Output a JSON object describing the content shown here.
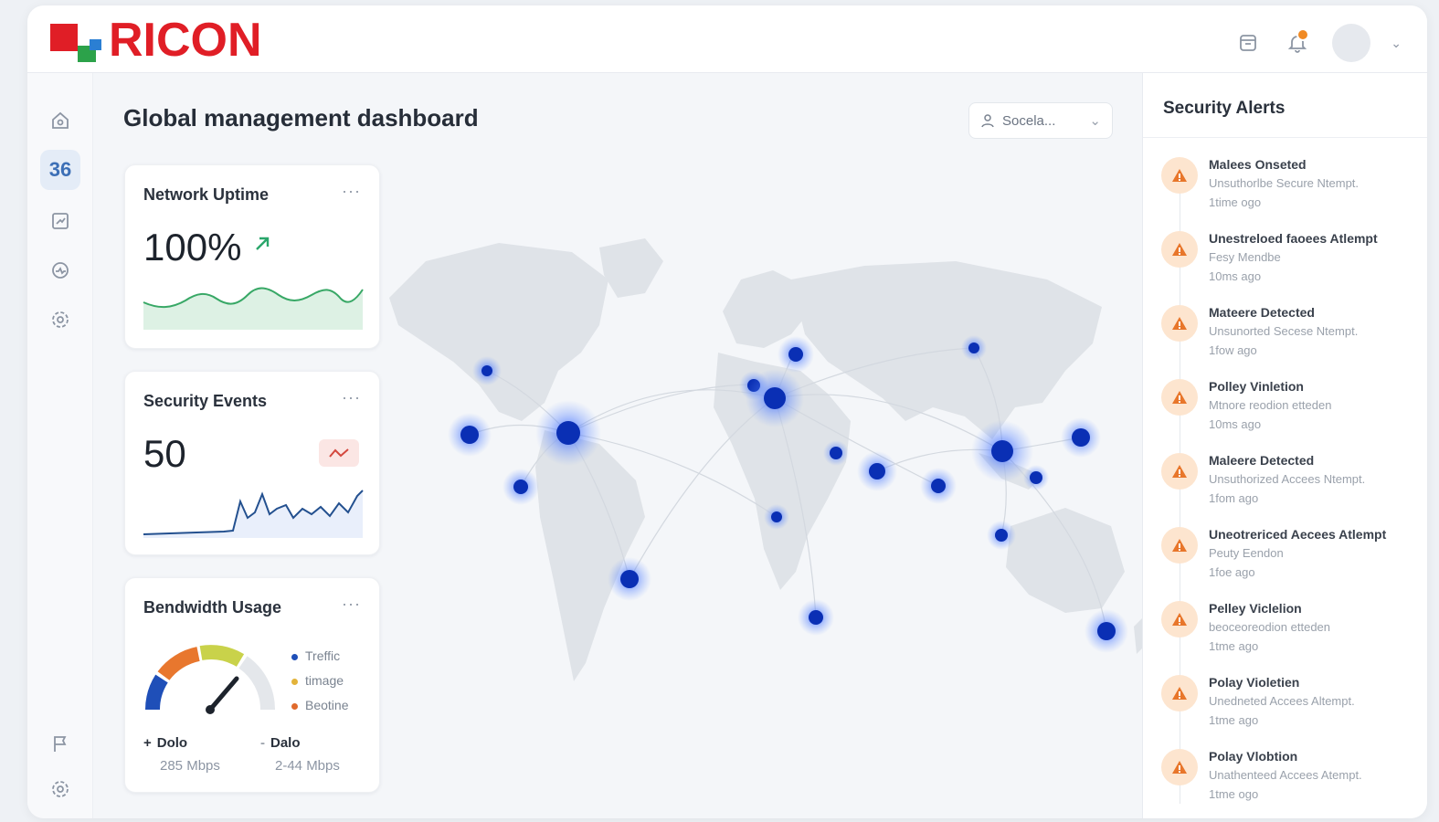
{
  "brand": {
    "name": "RICON"
  },
  "header": {
    "notification_icon": "bell-icon",
    "window_icon": "window-icon"
  },
  "sidebar": {
    "items": [
      {
        "icon": "home-icon"
      },
      {
        "icon": "dashboard-icon",
        "label": "36",
        "active": true
      },
      {
        "icon": "reports-icon"
      },
      {
        "icon": "monitor-icon"
      },
      {
        "icon": "settings-icon"
      }
    ],
    "bottom": [
      {
        "icon": "flag-icon"
      },
      {
        "icon": "gear-icon"
      }
    ]
  },
  "main": {
    "title": "Global management dashboard",
    "selector": {
      "value": "Socela..."
    }
  },
  "cards": {
    "uptime": {
      "title": "Network Uptime",
      "value": "100%",
      "more": "···"
    },
    "events": {
      "title": "Security Events",
      "value": "50",
      "more": "···"
    },
    "bandwidth": {
      "title": "Bendwidth Usage",
      "more": "···",
      "legend": [
        {
          "label": "Treffic",
          "color": "#1f4fb8"
        },
        {
          "label": "timage",
          "color": "#e3b33a"
        },
        {
          "label": "Beotine",
          "color": "#e06a2c"
        }
      ],
      "stats": [
        {
          "key": "Dolo",
          "value": "285 Mbps",
          "marker": "+"
        },
        {
          "key": "Dalo",
          "value": "2-44 Mbps",
          "marker": "-"
        }
      ]
    }
  },
  "alerts": {
    "title": "Security Alerts",
    "items": [
      {
        "title": "Malees Onseted",
        "detail": "Unsuthorlbe Secure Ntempt.",
        "time": "1time ogo"
      },
      {
        "title": "Unestreloed faoees Atlempt",
        "detail": "Fesy Mendbe",
        "time": "10ms ago"
      },
      {
        "title": "Mateere Detected",
        "detail": "Unsunorted Secese Ntempt.",
        "time": "1fow ago"
      },
      {
        "title": "Polley Vinletion",
        "detail": "Mtnore reodion etteden",
        "time": "10ms ago"
      },
      {
        "title": "Maleere Detected",
        "detail": "Unsuthorized Accees Ntempt.",
        "time": "1fom ago"
      },
      {
        "title": "Uneotrericed Aecees Atlempt",
        "detail": "Peuty Eendon",
        "time": "1foe ago"
      },
      {
        "title": "Pelley Viclelion",
        "detail": "beoceoreodion etteden",
        "time": "1tme ago"
      },
      {
        "title": "Polay Violetien",
        "detail": "Unedneted Accees Altempt.",
        "time": "1tme ago"
      },
      {
        "title": "Polay Vlobtion",
        "detail": "Unathenteed Accees Atempt.",
        "time": "1tme ogo"
      }
    ]
  }
}
